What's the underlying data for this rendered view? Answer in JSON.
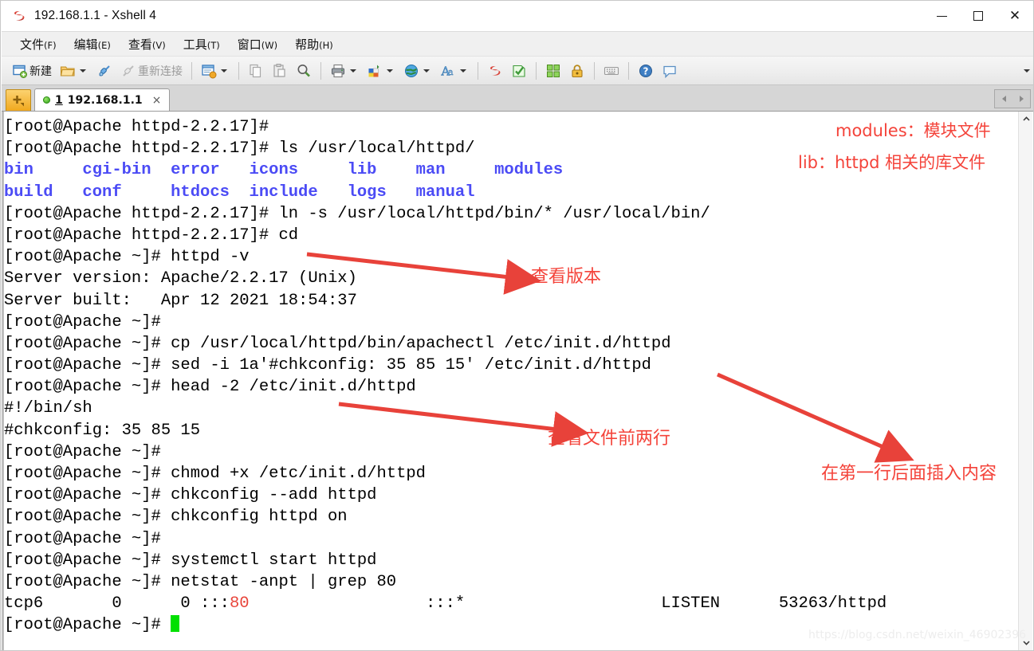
{
  "window": {
    "title": "192.168.1.1 - Xshell 4",
    "app_icon": "xshell-logo-icon",
    "minimize_label": "—",
    "maximize_label": "",
    "close_label": "✕"
  },
  "menubar": {
    "items": [
      {
        "label": "文件",
        "mnemonic": "(F)",
        "name": "menu-file"
      },
      {
        "label": "编辑",
        "mnemonic": "(E)",
        "name": "menu-edit"
      },
      {
        "label": "查看",
        "mnemonic": "(V)",
        "name": "menu-view"
      },
      {
        "label": "工具",
        "mnemonic": "(T)",
        "name": "menu-tools"
      },
      {
        "label": "窗口",
        "mnemonic": "(W)",
        "name": "menu-window"
      },
      {
        "label": "帮助",
        "mnemonic": "(H)",
        "name": "menu-help"
      }
    ]
  },
  "toolbar": {
    "new_label": "新建",
    "reconnect_label": "重新连接",
    "overflow_label": "▾"
  },
  "tabbar": {
    "new_tab_label": "+",
    "tab_number": "1",
    "tab_title": "192.168.1.1",
    "tab_close": "×"
  },
  "terminal": {
    "prompt_dir": "[root@Apache httpd-2.2.17]#",
    "prompt_home": "[root@Apache ~]#",
    "lines": [
      {
        "type": "plain",
        "text": "[root@Apache httpd-2.2.17]# "
      },
      {
        "type": "plain",
        "text": "[root@Apache httpd-2.2.17]# ls /usr/local/httpd/"
      },
      {
        "type": "dirs",
        "text": "bin     cgi-bin  error   icons     lib    man     modules"
      },
      {
        "type": "dirs",
        "text": "build   conf     htdocs  include   logs   manual"
      },
      {
        "type": "plain",
        "text": "[root@Apache httpd-2.2.17]# ln -s /usr/local/httpd/bin/* /usr/local/bin/"
      },
      {
        "type": "plain",
        "text": "[root@Apache httpd-2.2.17]# cd"
      },
      {
        "type": "plain",
        "text": "[root@Apache ~]# httpd -v"
      },
      {
        "type": "plain",
        "text": "Server version: Apache/2.2.17 (Unix)"
      },
      {
        "type": "plain",
        "text": "Server built:   Apr 12 2021 18:54:37"
      },
      {
        "type": "plain",
        "text": "[root@Apache ~]# "
      },
      {
        "type": "plain",
        "text": "[root@Apache ~]# cp /usr/local/httpd/bin/apachectl /etc/init.d/httpd"
      },
      {
        "type": "plain",
        "text": "[root@Apache ~]# sed -i 1a'#chkconfig: 35 85 15' /etc/init.d/httpd"
      },
      {
        "type": "plain",
        "text": "[root@Apache ~]# head -2 /etc/init.d/httpd"
      },
      {
        "type": "plain",
        "text": "#!/bin/sh"
      },
      {
        "type": "plain",
        "text": "#chkconfig: 35 85 15"
      },
      {
        "type": "plain",
        "text": "[root@Apache ~]# "
      },
      {
        "type": "plain",
        "text": "[root@Apache ~]# chmod +x /etc/init.d/httpd"
      },
      {
        "type": "plain",
        "text": "[root@Apache ~]# chkconfig --add httpd"
      },
      {
        "type": "plain",
        "text": "[root@Apache ~]# chkconfig httpd on"
      },
      {
        "type": "plain",
        "text": "[root@Apache ~]# "
      },
      {
        "type": "plain",
        "text": "[root@Apache ~]# systemctl start httpd"
      },
      {
        "type": "plain",
        "text": "[root@Apache ~]# netstat -anpt | grep 80"
      },
      {
        "type": "netstat",
        "pre": "tcp6       0      0 :::",
        "match": "80",
        "post": "                  :::*                    LISTEN      53263/httpd"
      },
      {
        "type": "cursor",
        "text": "[root@Apache ~]# "
      }
    ],
    "directory_listing_row1": [
      "bin",
      "cgi-bin",
      "error",
      "icons",
      "lib",
      "man",
      "modules"
    ],
    "directory_listing_row2": [
      "build",
      "conf",
      "htdocs",
      "include",
      "logs",
      "manual"
    ],
    "netstat_row": {
      "proto": "tcp6",
      "recv_q": "0",
      "send_q": "0",
      "local_address": ":::80",
      "foreign_address": ":::*",
      "state": "LISTEN",
      "pid_program": "53263/httpd"
    },
    "colors": {
      "directory": "#4b4bf5",
      "grep_match": "#e8443a",
      "cursor": "#00e000",
      "text": "#000000",
      "background": "#ffffff"
    }
  },
  "annotations": {
    "modules": "modules：模块文件",
    "lib": "lib：httpd 相关的库文件",
    "version": "查看版本",
    "head": "查看文件前两行",
    "insert": "在第一行后面插入内容",
    "color": "#f4433a"
  },
  "scrollbar": {
    "up_arrow": "^",
    "down_arrow": "ˇ"
  },
  "watermark": "https://blog.csdn.net/weixin_46902396"
}
